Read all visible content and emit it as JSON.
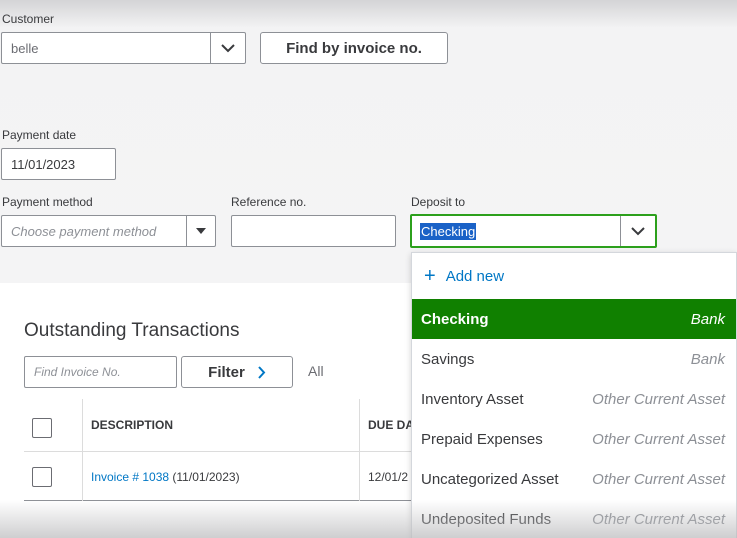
{
  "customer": {
    "label": "Customer",
    "value": "belle",
    "find_button": "Find by invoice no."
  },
  "payment_date": {
    "label": "Payment date",
    "value": "11/01/2023"
  },
  "payment_method": {
    "label": "Payment method",
    "placeholder": "Choose payment method"
  },
  "reference_no": {
    "label": "Reference no.",
    "value": ""
  },
  "deposit_to": {
    "label": "Deposit to",
    "value": "Checking",
    "add_new": "Add new",
    "options": [
      {
        "name": "Checking",
        "type": "Bank",
        "selected": true
      },
      {
        "name": "Savings",
        "type": "Bank"
      },
      {
        "name": "Inventory Asset",
        "type": "Other Current Asset"
      },
      {
        "name": "Prepaid Expenses",
        "type": "Other Current Asset"
      },
      {
        "name": "Uncategorized Asset",
        "type": "Other Current Asset"
      },
      {
        "name": "Undeposited Funds",
        "type": "Other Current Asset"
      }
    ]
  },
  "outstanding": {
    "title": "Outstanding Transactions",
    "search_placeholder": "Find Invoice No.",
    "filter_label": "Filter",
    "all_label": "All",
    "columns": [
      "DESCRIPTION",
      "DUE DA"
    ],
    "rows": [
      {
        "link": "Invoice # 1038",
        "date": "(11/01/2023)",
        "due": "12/01/2"
      }
    ]
  },
  "colors": {
    "accent_green": "#108000",
    "link_blue": "#0077c5",
    "selection_blue": "#1a62c7"
  },
  "icons": {
    "dropdown": "chevron-down-icon",
    "filter": "chevron-right-icon",
    "add": "plus-icon"
  }
}
